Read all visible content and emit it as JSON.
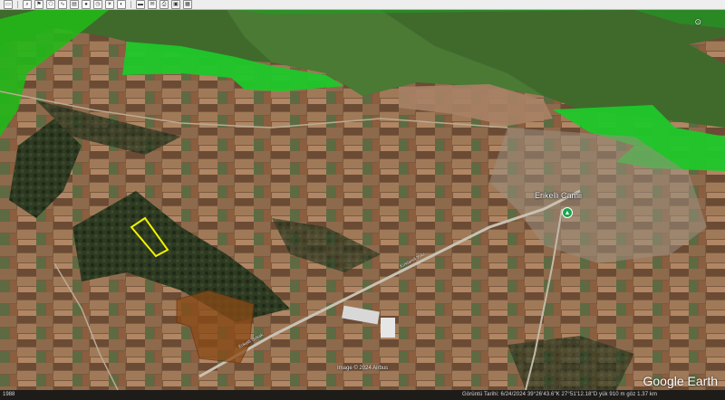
{
  "toolbar": {
    "buttons": [
      {
        "name": "sidebar-toggle-icon",
        "glyph": "▭"
      },
      {
        "name": "search-icon",
        "glyph": "⌕"
      },
      {
        "name": "placemark-icon",
        "glyph": "⚑"
      },
      {
        "name": "polygon-icon",
        "glyph": "⬠"
      },
      {
        "name": "path-icon",
        "glyph": "∿"
      },
      {
        "name": "overlay-icon",
        "glyph": "▤"
      },
      {
        "name": "tour-icon",
        "glyph": "●"
      },
      {
        "name": "historical-imagery-icon",
        "glyph": "◷"
      },
      {
        "name": "sunlight-icon",
        "glyph": "☀"
      },
      {
        "name": "planet-icon",
        "glyph": "◐"
      },
      {
        "name": "ruler-icon",
        "glyph": "▬"
      },
      {
        "name": "email-icon",
        "glyph": "✉"
      },
      {
        "name": "print-icon",
        "glyph": "⎙"
      },
      {
        "name": "save-image-icon",
        "glyph": "▣"
      },
      {
        "name": "maps-icon",
        "glyph": "▦"
      }
    ]
  },
  "map": {
    "place_label": "Erikelli Camii",
    "imagery_credit": "Image © 2024 Airbus",
    "road_label_1": "Erikelli Sokak",
    "road_label_2": "Kırklareli Yolu"
  },
  "status": {
    "left": "1988",
    "middle": "Görüntü Tarihi: 6/24/2024   39°26'43.6\"K 27°51'12.18\"D  yük 910 m   göz 1.37 km"
  },
  "brand": "Google Earth",
  "colors": {
    "highlight_green": "#22d42a",
    "yellow_outline": "#f2f200",
    "brown_area": "#8b4a16"
  }
}
